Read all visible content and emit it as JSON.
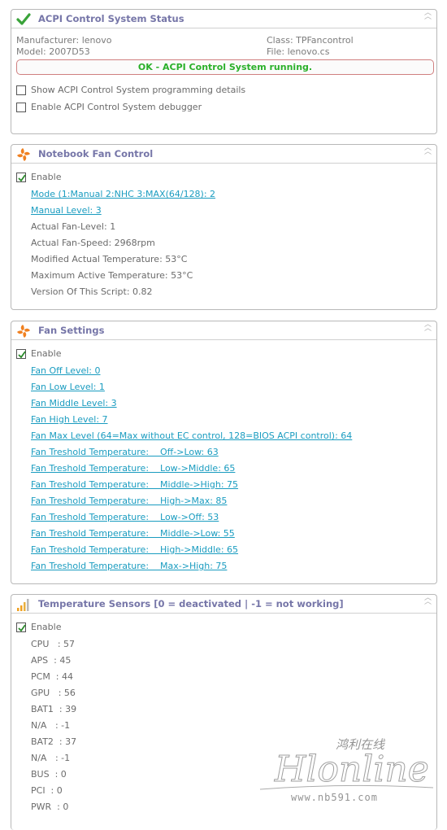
{
  "acpi": {
    "title": "ACPI Control System Status",
    "manufacturer": "Manufacturer: lenovo",
    "model": "Model: 2007D53",
    "class": "Class: TPFancontrol",
    "file": "File: lenovo.cs",
    "status": "OK - ACPI Control System running.",
    "opt_programming": "Show ACPI Control System programming details",
    "opt_debugger": "Enable ACPI Control System debugger",
    "status_color": "#2ab02a"
  },
  "fan_control": {
    "title": "Notebook Fan Control",
    "enable_label": "Enable",
    "mode_link": "Mode (1:Manual 2:NHC 3:MAX(64/128): 2",
    "manual_level_link": "Manual Level: 3",
    "rows": [
      "Actual Fan-Level: 1",
      "Actual Fan-Speed: 2968rpm",
      "Modified Actual Temperature: 53°C",
      "Maximum Active Temperature: 53°C",
      "Version Of This Script: 0.82"
    ]
  },
  "fan_settings": {
    "title": "Fan Settings",
    "enable_label": "Enable",
    "links": [
      "Fan Off Level: 0",
      "Fan Low Level: 1",
      "Fan Middle Level: 3",
      "Fan High Level: 7",
      "Fan Max Level (64=Max without EC control, 128=BIOS ACPI control): 64",
      "Fan Treshold Temperature:    Off->Low: 63",
      "Fan Treshold Temperature:    Low->Middle: 65",
      "Fan Treshold Temperature:    Middle->High: 75",
      "Fan Treshold Temperature:    High->Max: 85",
      "Fan Treshold Temperature:    Low->Off: 53",
      "Fan Treshold Temperature:    Middle->Low: 55",
      "Fan Treshold Temperature:    High->Middle: 65",
      "Fan Treshold Temperature:    Max->High: 75"
    ]
  },
  "sensors": {
    "title": "Temperature Sensors [0 = deactivated | -1 = not working]",
    "enable_label": "Enable",
    "rows": [
      "CPU   : 57",
      "APS  : 45",
      "PCM  : 44",
      "GPU   : 56",
      "BAT1  : 39",
      "N/A   : -1",
      "BAT2  : 37",
      "N/A   : -1",
      "BUS  : 0",
      "PCI  : 0",
      "PWR  : 0"
    ]
  },
  "icons": {
    "acpi": "checkmark-icon",
    "fan": "fan-icon",
    "sensors": "signal-bars-icon",
    "collapse": "double-chevron-up-icon"
  },
  "colors": {
    "title": "#7676a8",
    "link": "#1a9cc0",
    "fan_icon": "#f08020"
  },
  "watermark": {
    "script": "Hlonline",
    "chinese": "鸿利在线",
    "url": "www.nb591.com"
  }
}
